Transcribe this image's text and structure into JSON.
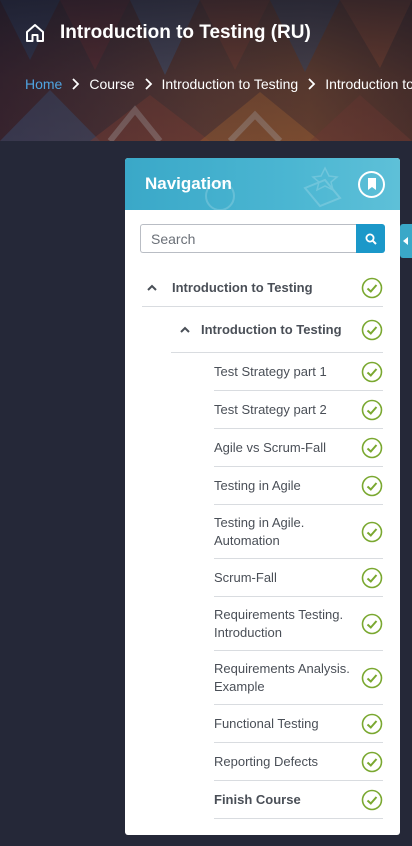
{
  "header": {
    "title": "Introduction to Testing (RU)",
    "breadcrumb": [
      "Home",
      "Course",
      "Introduction to Testing",
      "Introduction to Testing"
    ]
  },
  "nav": {
    "title": "Navigation",
    "search_placeholder": "Search",
    "section": "Introduction to Testing",
    "subsection": "Introduction to Testing",
    "items": [
      "Test Strategy part 1",
      "Test Strategy part 2",
      "Agile vs Scrum-Fall",
      "Testing in Agile",
      "Testing in Agile. Automation",
      "Scrum-Fall",
      "Requirements Testing. Introduction",
      "Requirements Analysis. Example",
      "Functional Testing",
      "Reporting Defects",
      "Finish Course"
    ]
  },
  "colors": {
    "accent": "#3aa8c8",
    "search_button": "#1b98c9",
    "complete_check": "#7aa830",
    "breadcrumb_link": "#4fa3e0",
    "page_background": "#252838"
  },
  "icons": {
    "home": "home-icon",
    "breadcrumb_separator": "chevron-right-icon",
    "bookmark": "bookmark-icon",
    "search": "search-icon",
    "collapse": "collapse-left-icon",
    "expand_state": "chevron-up-icon",
    "completed": "check-circle-icon"
  }
}
